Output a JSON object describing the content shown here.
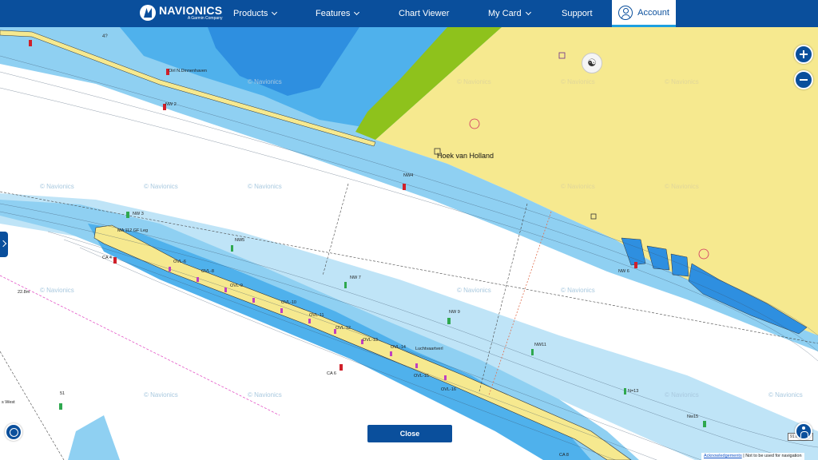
{
  "header": {
    "brand_name": "NAVIONICS",
    "brand_sub": "A Garmin Company",
    "nav": {
      "products": "Products",
      "features": "Features",
      "chart_viewer": "Chart Viewer",
      "my_card": "My Card",
      "support": "Support",
      "account": "Account"
    }
  },
  "map": {
    "labels": {
      "place_main": "Hoek van Holland",
      "oirl": "Oirl N.Dinnenhaven",
      "nw2": "NW 2",
      "nw4": "NW4",
      "nw3": "NW 3",
      "nw5": "NW5",
      "nw6": "NW 6",
      "nw7": "NW 7",
      "nw9": "NW 9",
      "nw11": "NW11",
      "nw13": "N=13",
      "nw15": "Nw15",
      "ma112": "MA 112 GF Leg",
      "ca4": "CA 4",
      "ca6": "CA 6",
      "ca8": "CA 8",
      "ovl6": "OVL-6",
      "ovl8": "OVL-8",
      "ovl9": "OVL-9",
      "ovl10": "OVL-10",
      "ovl11": "OVL-11",
      "ovl12": "OVL-12",
      "ovl13": "OVL-13",
      "ovl14": "OVL-14",
      "ovl15": "OVL-15",
      "ovl16": "OVL-16",
      "luchtvaartverl": "Luchtvaartverl",
      "west": "s West",
      "depth_22": "22.8m",
      "m51": "51",
      "wm": "© Navionics"
    },
    "scale": "91.05",
    "footer": {
      "ack": "Acknowledgements",
      "note": "Not to be used for navigation"
    }
  },
  "controls": {
    "close": "Close",
    "places_icon": "fork-knife-icon"
  },
  "colors": {
    "header": "#0a4f9c",
    "land": "#f6e98f",
    "deep_water": "#ffffff",
    "mid_water": "#8fd0f2",
    "shallow_water": "#2e8fe0",
    "green_shore": "#8ec21c",
    "accent": "#1e9fe0"
  }
}
